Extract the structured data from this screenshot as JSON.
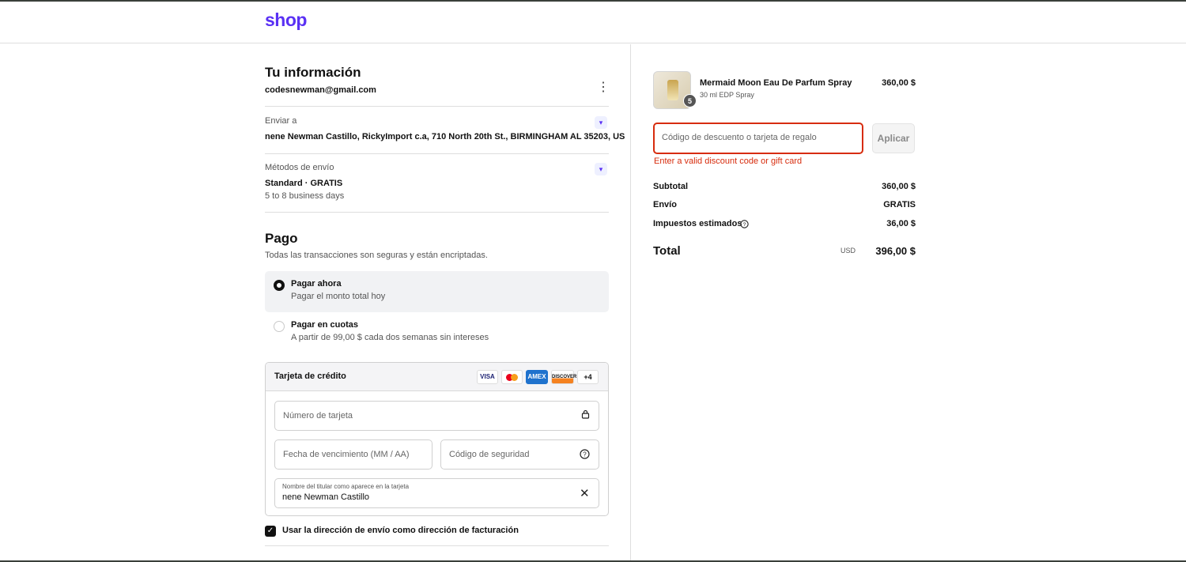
{
  "brand": {
    "logo": "shop",
    "color": "#5a31f4"
  },
  "info": {
    "title": "Tu información",
    "email": "codesnewman@gmail.com",
    "ship_label": "Enviar a",
    "ship_address": "nene Newman Castillo, RickyImport c.a, 710 North 20th St., BIRMINGHAM AL 35203, US",
    "method_label": "Métodos de envío",
    "method_name": "Standard · GRATIS",
    "method_days": "5 to 8 business days"
  },
  "payment": {
    "title": "Pago",
    "subtitle": "Todas las transacciones son seguras y están encriptadas.",
    "options": [
      {
        "label": "Pagar ahora",
        "desc": "Pagar el monto total hoy",
        "selected": true
      },
      {
        "label": "Pagar en cuotas",
        "desc": "A partir de 99,00 $ cada dos semanas sin intereses",
        "selected": false
      }
    ],
    "card": {
      "title": "Tarjeta de crédito",
      "brands": [
        "VISA",
        "MC",
        "AMEX",
        "DISCOVER",
        "+4"
      ],
      "number_placeholder": "Número de tarjeta",
      "expiry_placeholder": "Fecha de vencimiento (MM / AA)",
      "cvc_placeholder": "Código de seguridad",
      "holder_label": "Nombre del titular como aparece en la tarjeta",
      "holder_value": "nene Newman Castillo"
    },
    "billing_same": "Usar la dirección de envío como dirección de facturación"
  },
  "summary": {
    "product_name": "Mermaid Moon Eau De Parfum Spray",
    "product_variant": "30 ml EDP Spray",
    "product_price": "360,00 $",
    "quantity": "5",
    "discount_placeholder": "Código de descuento o tarjeta de regalo",
    "apply_label": "Aplicar",
    "error": "Enter a valid discount code or gift card",
    "subtotal_label": "Subtotal",
    "subtotal": "360,00 $",
    "shipping_label": "Envío",
    "shipping": "GRATIS",
    "tax_label": "Impuestos estimados",
    "tax": "36,00 $",
    "total_label": "Total",
    "currency": "USD",
    "total": "396,00 $",
    "error_color": "#d72c0d"
  }
}
